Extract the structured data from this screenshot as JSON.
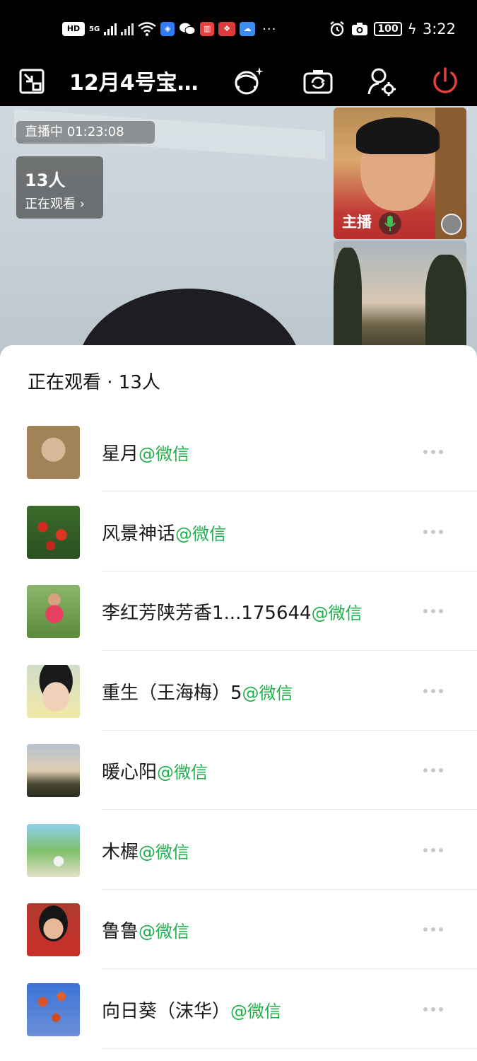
{
  "status_bar": {
    "hd_label": "HD",
    "network_label": "5G",
    "time": "3:22",
    "battery": "100",
    "more": "···"
  },
  "header": {
    "title": "12月4号宝…",
    "icons": [
      "exit-fullscreen-icon",
      "beauty-filter-icon",
      "switch-camera-icon",
      "user-settings-icon",
      "power-icon"
    ],
    "power_color": "#e8413b"
  },
  "live": {
    "status": "直播中 01:23:08",
    "viewer_count": "13人",
    "viewer_label": "正在观看 ›",
    "host_tag": "主播"
  },
  "sheet": {
    "title": "正在观看 · 13人",
    "source_suffix": "@微信",
    "viewers": [
      {
        "name": "星月",
        "source": "@微信"
      },
      {
        "name": "风景神话",
        "source": "@微信"
      },
      {
        "name": "李红芳陕芳香1...175644",
        "source": "@微信"
      },
      {
        "name": "重生（王海梅）5",
        "source": "@微信"
      },
      {
        "name": "暖心阳",
        "source": "@微信"
      },
      {
        "name": "木樨",
        "source": "@微信"
      },
      {
        "name": "鲁鲁",
        "source": "@微信"
      },
      {
        "name": "向日葵（沫华）",
        "source": "@微信"
      }
    ]
  },
  "colors": {
    "accent_green": "#21b04b",
    "power_red": "#e8413b"
  }
}
